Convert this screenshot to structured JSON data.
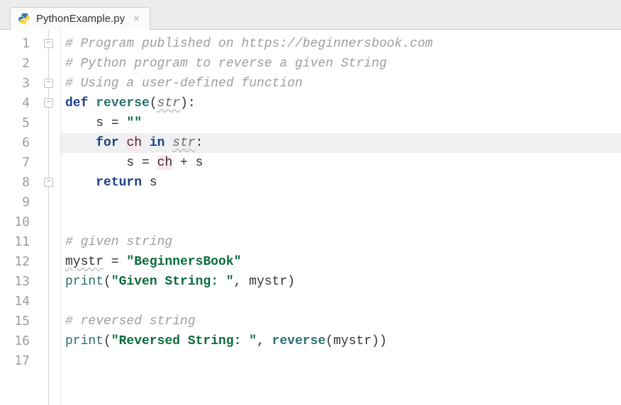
{
  "tab": {
    "filename": "PythonExample.py",
    "close_glyph": "×"
  },
  "gutter": {
    "numbers": [
      "1",
      "2",
      "3",
      "4",
      "5",
      "6",
      "7",
      "8",
      "9",
      "10",
      "11",
      "12",
      "13",
      "14",
      "15",
      "16",
      "17"
    ]
  },
  "code": {
    "line1_comment": "# Program published on https://beginnersbook.com",
    "line2_comment": "# Python program to reverse a given String",
    "line3_comment": "# Using a user-defined function",
    "l4": {
      "kw_def": "def ",
      "fn": "reverse",
      "lp": "(",
      "param": "str",
      "rp_colon": "):"
    },
    "l5": {
      "indent": "    ",
      "var": "s",
      "assign": " = ",
      "str": "\"\""
    },
    "l6": {
      "indent": "    ",
      "kw_for": "for ",
      "ch": "ch",
      "kw_in": " in ",
      "it": "str",
      "colon": ":"
    },
    "l7": {
      "indent": "        ",
      "var": "s",
      "assign": " = ",
      "ch": "ch",
      "plus": " + ",
      "s2": "s"
    },
    "l8": {
      "indent": "    ",
      "kw_return": "return ",
      "var": "s"
    },
    "line11_comment": "# given string",
    "l12": {
      "var": "mystr",
      "assign": " = ",
      "str": "\"BeginnersBook\""
    },
    "l13": {
      "fn": "print",
      "lp": "(",
      "str": "\"Given String: \"",
      "comma": ", ",
      "arg": "mystr",
      "rp": ")"
    },
    "line15_comment": "# reversed string",
    "l16": {
      "fn": "print",
      "lp": "(",
      "str": "\"Reversed String: \"",
      "comma": ", ",
      "call": "reverse",
      "lp2": "(",
      "arg": "mystr",
      "rp2": ")",
      "rp": ")"
    }
  },
  "fold": {
    "minus": "−"
  }
}
